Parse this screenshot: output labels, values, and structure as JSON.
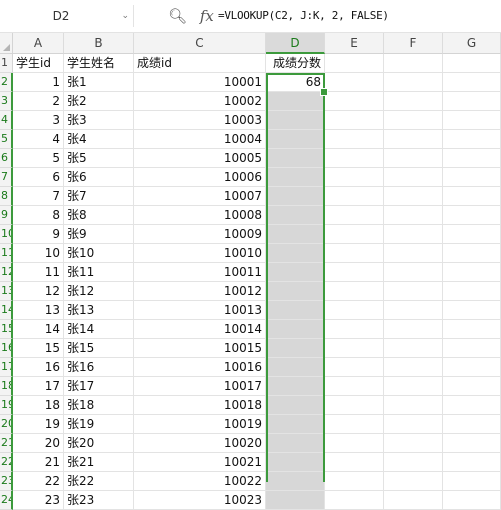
{
  "formula_bar": {
    "name_box": "D2",
    "dropdown_glyph": "⌄",
    "zoom_icon": "zoom-formula-icon",
    "fx_label": "fx",
    "formula": "=VLOOKUP(C2, J:K, 2, FALSE)"
  },
  "columns": [
    "A",
    "B",
    "C",
    "D",
    "E",
    "F",
    "G"
  ],
  "selected_column": "D",
  "header_row": {
    "row": "1",
    "a": "学生id",
    "b": "学生姓名",
    "c": "成绩id",
    "d": "成绩分数"
  },
  "active_cell": {
    "ref": "D2",
    "value": "68"
  },
  "rows": [
    {
      "row": "2",
      "a": "1",
      "b": "张1",
      "c": "10001",
      "d": "68"
    },
    {
      "row": "3",
      "a": "2",
      "b": "张2",
      "c": "10002",
      "d": ""
    },
    {
      "row": "4",
      "a": "3",
      "b": "张3",
      "c": "10003",
      "d": ""
    },
    {
      "row": "5",
      "a": "4",
      "b": "张4",
      "c": "10004",
      "d": ""
    },
    {
      "row": "6",
      "a": "5",
      "b": "张5",
      "c": "10005",
      "d": ""
    },
    {
      "row": "7",
      "a": "6",
      "b": "张6",
      "c": "10006",
      "d": ""
    },
    {
      "row": "8",
      "a": "7",
      "b": "张7",
      "c": "10007",
      "d": ""
    },
    {
      "row": "9",
      "a": "8",
      "b": "张8",
      "c": "10008",
      "d": ""
    },
    {
      "row": "10",
      "a": "9",
      "b": "张9",
      "c": "10009",
      "d": ""
    },
    {
      "row": "11",
      "a": "10",
      "b": "张10",
      "c": "10010",
      "d": ""
    },
    {
      "row": "12",
      "a": "11",
      "b": "张11",
      "c": "10011",
      "d": ""
    },
    {
      "row": "13",
      "a": "12",
      "b": "张12",
      "c": "10012",
      "d": ""
    },
    {
      "row": "14",
      "a": "13",
      "b": "张13",
      "c": "10013",
      "d": ""
    },
    {
      "row": "15",
      "a": "14",
      "b": "张14",
      "c": "10014",
      "d": ""
    },
    {
      "row": "16",
      "a": "15",
      "b": "张15",
      "c": "10015",
      "d": ""
    },
    {
      "row": "17",
      "a": "16",
      "b": "张16",
      "c": "10016",
      "d": ""
    },
    {
      "row": "18",
      "a": "17",
      "b": "张17",
      "c": "10017",
      "d": ""
    },
    {
      "row": "19",
      "a": "18",
      "b": "张18",
      "c": "10018",
      "d": ""
    },
    {
      "row": "20",
      "a": "19",
      "b": "张19",
      "c": "10019",
      "d": ""
    },
    {
      "row": "21",
      "a": "20",
      "b": "张20",
      "c": "10020",
      "d": ""
    },
    {
      "row": "22",
      "a": "21",
      "b": "张21",
      "c": "10021",
      "d": ""
    },
    {
      "row": "23",
      "a": "22",
      "b": "张22",
      "c": "10022",
      "d": ""
    },
    {
      "row": "24",
      "a": "23",
      "b": "张23",
      "c": "10023",
      "d": ""
    }
  ],
  "colors": {
    "selection_green": "#3c9a3c",
    "selected_column_fill": "#d7d7d7",
    "header_fill": "#f3f3f3"
  }
}
